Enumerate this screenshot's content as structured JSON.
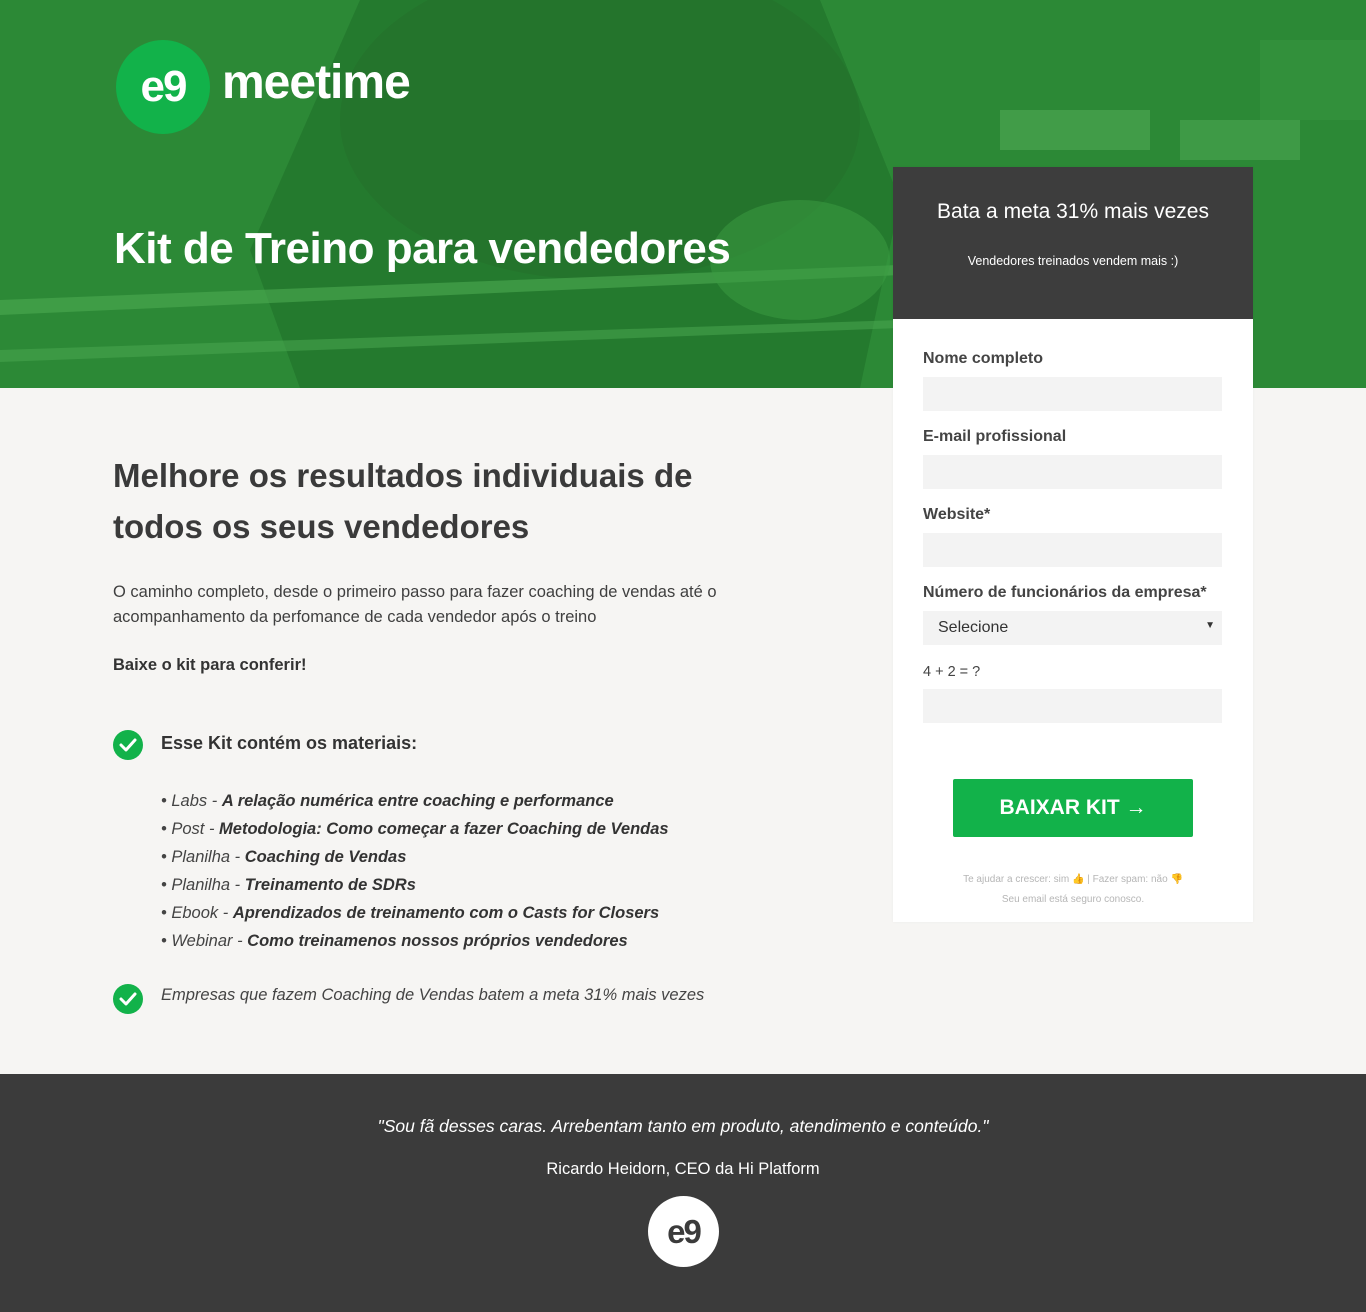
{
  "brand": {
    "logo_mark": "e9",
    "logo_word": "meetime",
    "accent": "#12b24a",
    "dark": "#3d3d3d"
  },
  "hero": {
    "title": "Kit de Treino para vendedores"
  },
  "main": {
    "heading": "Melhore os resultados individuais de todos os seus vendedores",
    "intro": "O caminho completo, desde o primeiro passo para fazer coaching de vendas até o acompanhamento da perfomance de cada vendedor após o treino",
    "cta": "Baixe o kit para conferir!",
    "kit_heading": "Esse Kit contém os materiais:",
    "materials": [
      {
        "type": "• Labs - ",
        "title": "A relação numérica entre coaching e performance"
      },
      {
        "type": "• Post - ",
        "title": "Metodologia: Como começar a fazer Coaching de Vendas"
      },
      {
        "type": "• Planilha - ",
        "title": "Coaching de Vendas"
      },
      {
        "type": "• Planilha - ",
        "title": "Treinamento de SDRs"
      },
      {
        "type": "• Ebook - ",
        "title": "Aprendizados de treinamento com o Casts for Closers"
      },
      {
        "type": "• Webinar - ",
        "title": "Como treinamenos nossos próprios vendedores"
      }
    ],
    "fact": "Empresas que fazem Coaching de Vendas batem a meta 31% mais vezes"
  },
  "form": {
    "title": "Bata a meta 31% mais vezes",
    "subtitle": "Vendedores treinados vendem mais :)",
    "name_label": "Nome completo",
    "name_value": "",
    "email_label": "E-mail profissional",
    "email_value": "",
    "website_label": "Website*",
    "website_value": "",
    "employees_label": "Número de funcionários da empresa*",
    "employees_selected": "Selecione",
    "captcha_label": "4 + 2 = ?",
    "captcha_value": "",
    "submit_label": "BAIXAR KIT →",
    "foot_line1_a": "Te ajudar a crescer: sim",
    "foot_line1_sep": " | ",
    "foot_line1_b": "Fazer spam: não",
    "foot_line2": "Seu email está seguro conosco."
  },
  "footer": {
    "quote": "\"Sou fã desses caras. Arrebentam tanto em produto, atendimento e conteúdo.\"",
    "author": "Ricardo Heidorn, CEO da Hi Platform",
    "logo_mark": "e9"
  }
}
